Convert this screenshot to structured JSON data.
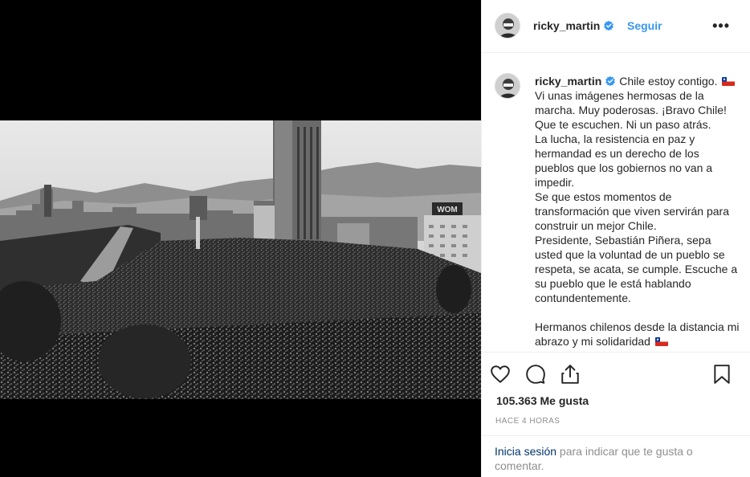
{
  "post": {
    "username": "ricky_martin",
    "follow_label": "Seguir",
    "more_label": "•••",
    "caption_text": "Chile estoy contigo.",
    "caption_body": "Vi unas imágenes hermosas de la marcha. Muy poderosas. ¡Bravo Chile! Que te escuchen. Ni un paso atrás.\nLa lucha, la resistencia en paz y hermandad es un derecho de los pueblos que los gobiernos no van a impedir.\nSe que estos momentos de transformación que viven servirán para construir un mejor Chile.\nPresidente, Sebastián Piñera, sepa usted que la voluntad de un pueblo se respeta, se acata, se cumple. Escuche a su pueblo que le está hablando contundentemente.\n\nHermanos chilenos desde la distancia mi abrazo y mi solidaridad",
    "likes": "105.363 Me gusta",
    "time_ago": "HACE 4 HORAS",
    "login_link": "Inicia sesión",
    "login_rest": " para indicar que te gusta o comentar."
  },
  "photo": {
    "billboard_text": "WOM"
  },
  "icons": {
    "verified": "verified-badge-icon",
    "like": "heart-icon",
    "comment": "comment-bubble-icon",
    "share": "share-icon",
    "save": "bookmark-icon",
    "flag": "chile-flag-emoji"
  },
  "colors": {
    "link_blue": "#3897f0",
    "verified_blue": "#3897f0",
    "muted": "#8e8e8e",
    "login_link": "#003569"
  }
}
